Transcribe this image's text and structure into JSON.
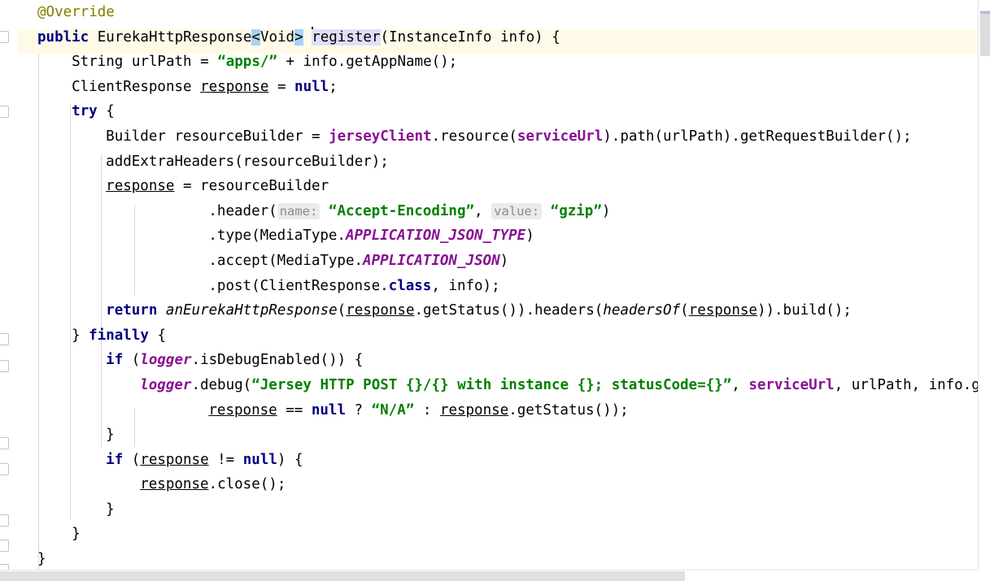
{
  "editor": {
    "language": "Java",
    "current_line_number": 2,
    "caret_line_text": "public EurekaHttpResponse<Void> register(InstanceInfo info) {",
    "colors": {
      "background": "#ffffff",
      "current_line_highlight": "#fffae8",
      "identifier_occurrence_highlight": "#dfdffb",
      "matching_bracket_highlight": "#a8d3f5",
      "annotation": "#808000",
      "keyword": "#000080",
      "string": "#008000",
      "field": "#871094",
      "static_field": "#871094",
      "plain_text": "#000000",
      "inline_hint_text": "#8c8c8c",
      "inline_hint_background": "#ebebeb",
      "indent_guide": "#d8d8d8",
      "scrollbar_thumb": "#dcdcdc",
      "scrollbar_marker": "#b4b4e8"
    }
  },
  "gutter": {
    "fold_marker_label": "fold-region-end",
    "fold_markers_count": 9
  },
  "scrollbars": {
    "vertical_thumb_label": "vertical-scroll-thumb",
    "horizontal_thumb_label": "horizontal-scroll-thumb"
  },
  "code": {
    "lines": [
      {
        "indent": 1,
        "tokens": [
          {
            "text": "@Override",
            "style": "anno"
          }
        ]
      },
      {
        "indent": 1,
        "current": true,
        "tokens": [
          {
            "text": "public",
            "style": "kw"
          },
          {
            "text": " EurekaHttpResponse",
            "style": "plain"
          },
          {
            "text": "<",
            "style": "plain",
            "hl": "bracket"
          },
          {
            "text": "Void",
            "style": "plain"
          },
          {
            "text": ">",
            "style": "plain",
            "hl": "bracket"
          },
          {
            "text": " ",
            "style": "plain"
          },
          {
            "text": "",
            "style": "caret"
          },
          {
            "text": "register",
            "style": "plain",
            "hl": "ident"
          },
          {
            "text": "(InstanceInfo info) {",
            "style": "plain"
          }
        ]
      },
      {
        "indent": 2,
        "tokens": [
          {
            "text": "String urlPath = ",
            "style": "plain"
          },
          {
            "text": "“apps/”",
            "style": "str"
          },
          {
            "text": " + info.getAppName();",
            "style": "plain"
          }
        ]
      },
      {
        "indent": 2,
        "tokens": [
          {
            "text": "ClientResponse ",
            "style": "plain"
          },
          {
            "text": "response",
            "style": "local"
          },
          {
            "text": " = ",
            "style": "plain"
          },
          {
            "text": "null",
            "style": "kw"
          },
          {
            "text": ";",
            "style": "plain"
          }
        ]
      },
      {
        "indent": 2,
        "tokens": [
          {
            "text": "try",
            "style": "kw"
          },
          {
            "text": " {",
            "style": "plain"
          }
        ]
      },
      {
        "indent": 3,
        "tokens": [
          {
            "text": "Builder resourceBuilder = ",
            "style": "plain"
          },
          {
            "text": "jerseyClient",
            "style": "field"
          },
          {
            "text": ".resource(",
            "style": "plain"
          },
          {
            "text": "serviceUrl",
            "style": "field"
          },
          {
            "text": ").path(urlPath).getRequestBuilder();",
            "style": "plain"
          }
        ]
      },
      {
        "indent": 3,
        "tokens": [
          {
            "text": "addExtraHeaders(resourceBuilder);",
            "style": "plain"
          }
        ]
      },
      {
        "indent": 3,
        "tokens": [
          {
            "text": "response",
            "style": "local"
          },
          {
            "text": " = resourceBuilder",
            "style": "plain"
          }
        ]
      },
      {
        "indent": 6,
        "tokens": [
          {
            "text": ".header(",
            "style": "plain"
          },
          {
            "text": "name:",
            "style": "hint"
          },
          {
            "text": " ",
            "style": "plain"
          },
          {
            "text": "“Accept-Encoding”",
            "style": "str"
          },
          {
            "text": ", ",
            "style": "plain"
          },
          {
            "text": "value:",
            "style": "hint"
          },
          {
            "text": " ",
            "style": "plain"
          },
          {
            "text": "“gzip”",
            "style": "str"
          },
          {
            "text": ")",
            "style": "plain"
          }
        ]
      },
      {
        "indent": 6,
        "tokens": [
          {
            "text": ".type(MediaType.",
            "style": "plain"
          },
          {
            "text": "APPLICATION_JSON_TYPE",
            "style": "static"
          },
          {
            "text": ")",
            "style": "plain"
          }
        ]
      },
      {
        "indent": 6,
        "tokens": [
          {
            "text": ".accept(MediaType.",
            "style": "plain"
          },
          {
            "text": "APPLICATION_JSON",
            "style": "static"
          },
          {
            "text": ")",
            "style": "plain"
          }
        ]
      },
      {
        "indent": 6,
        "tokens": [
          {
            "text": ".post(ClientResponse.",
            "style": "plain"
          },
          {
            "text": "class",
            "style": "kw"
          },
          {
            "text": ", info);",
            "style": "plain"
          }
        ]
      },
      {
        "indent": 3,
        "tokens": [
          {
            "text": "return",
            "style": "kw"
          },
          {
            "text": " ",
            "style": "plain"
          },
          {
            "text": "anEurekaHttpResponse",
            "style": "staticm"
          },
          {
            "text": "(",
            "style": "plain"
          },
          {
            "text": "response",
            "style": "local"
          },
          {
            "text": ".getStatus()).headers(",
            "style": "plain"
          },
          {
            "text": "headersOf",
            "style": "staticm"
          },
          {
            "text": "(",
            "style": "plain"
          },
          {
            "text": "response",
            "style": "local"
          },
          {
            "text": ")).build();",
            "style": "plain"
          }
        ]
      },
      {
        "indent": 2,
        "tokens": [
          {
            "text": "} ",
            "style": "plain"
          },
          {
            "text": "finally",
            "style": "kw"
          },
          {
            "text": " {",
            "style": "plain"
          }
        ]
      },
      {
        "indent": 3,
        "tokens": [
          {
            "text": "if",
            "style": "kw"
          },
          {
            "text": " (",
            "style": "plain"
          },
          {
            "text": "logger",
            "style": "static"
          },
          {
            "text": ".isDebugEnabled()) {",
            "style": "plain"
          }
        ]
      },
      {
        "indent": 4,
        "tokens": [
          {
            "text": "logger",
            "style": "static"
          },
          {
            "text": ".debug(",
            "style": "plain"
          },
          {
            "text": "“Jersey HTTP POST {}/{} with instance {}; statusCode={}”",
            "style": "str"
          },
          {
            "text": ", ",
            "style": "plain"
          },
          {
            "text": "serviceUrl",
            "style": "field"
          },
          {
            "text": ", urlPath, info.getId(),",
            "style": "plain"
          }
        ]
      },
      {
        "indent": 6,
        "tokens": [
          {
            "text": "response",
            "style": "local"
          },
          {
            "text": " == ",
            "style": "plain"
          },
          {
            "text": "null",
            "style": "kw"
          },
          {
            "text": " ? ",
            "style": "plain"
          },
          {
            "text": "“N/A”",
            "style": "str"
          },
          {
            "text": " : ",
            "style": "plain"
          },
          {
            "text": "response",
            "style": "local"
          },
          {
            "text": ".getStatus());",
            "style": "plain"
          }
        ]
      },
      {
        "indent": 3,
        "tokens": [
          {
            "text": "}",
            "style": "plain"
          }
        ]
      },
      {
        "indent": 3,
        "tokens": [
          {
            "text": "if",
            "style": "kw"
          },
          {
            "text": " (",
            "style": "plain"
          },
          {
            "text": "response",
            "style": "local"
          },
          {
            "text": " != ",
            "style": "plain"
          },
          {
            "text": "null",
            "style": "kw"
          },
          {
            "text": ") {",
            "style": "plain"
          }
        ]
      },
      {
        "indent": 4,
        "tokens": [
          {
            "text": "response",
            "style": "local"
          },
          {
            "text": ".close();",
            "style": "plain"
          }
        ]
      },
      {
        "indent": 3,
        "tokens": [
          {
            "text": "}",
            "style": "plain"
          }
        ]
      },
      {
        "indent": 2,
        "tokens": [
          {
            "text": "}",
            "style": "plain"
          }
        ]
      },
      {
        "indent": 1,
        "tokens": [
          {
            "text": "}",
            "style": "plain"
          }
        ]
      }
    ]
  }
}
